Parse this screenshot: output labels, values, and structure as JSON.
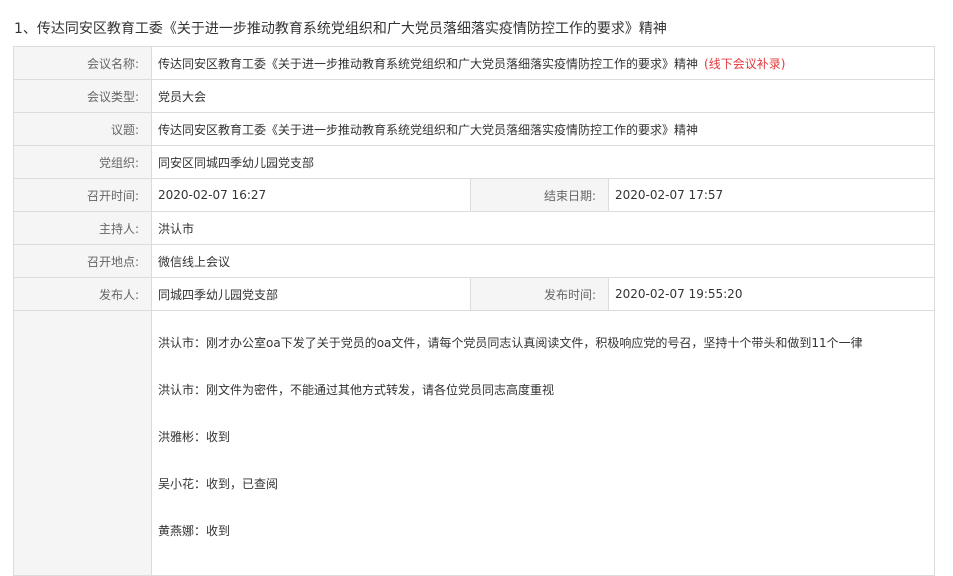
{
  "page": {
    "title": "1、传达同安区教育工委《关于进一步推动教育系统党组织和广大党员落细落实疫情防控工作的要求》精神"
  },
  "meeting": {
    "name_label": "会议名称:",
    "name_value": "传达同安区教育工委《关于进一步推动教育系统党组织和广大党员落细落实疫情防控工作的要求》精神",
    "name_note": "(线下会议补录)",
    "type_label": "会议类型:",
    "type_value": "党员大会",
    "topic_label": "议题:",
    "topic_value": "传达同安区教育工委《关于进一步推动教育系统党组织和广大党员落细落实疫情防控工作的要求》精神",
    "org_label": "党组织:",
    "org_value": "同安区同城四季幼儿园党支部",
    "start_label": "召开时间:",
    "start_value": "2020-02-07 16:27",
    "end_label": "结束日期:",
    "end_value": "2020-02-07 17:57",
    "host_label": "主持人:",
    "host_value": "洪认市",
    "location_label": "召开地点:",
    "location_value": "微信线上会议",
    "publisher_label": "发布人:",
    "publisher_value": "同城四季幼儿园党支部",
    "publish_time_label": "发布时间:",
    "publish_time_value": "2020-02-07 19:55:20"
  },
  "content": {
    "messages": [
      "洪认市：刚才办公室oa下发了关于党员的oa文件，请每个党员同志认真阅读文件，积极响应党的号召，坚持十个带头和做到11个一律",
      "洪认市：刚文件为密件，不能通过其他方式转发，请各位党员同志高度重视",
      "洪雅彬：收到",
      "吴小花：收到，已查阅",
      "黄燕娜：收到"
    ]
  }
}
